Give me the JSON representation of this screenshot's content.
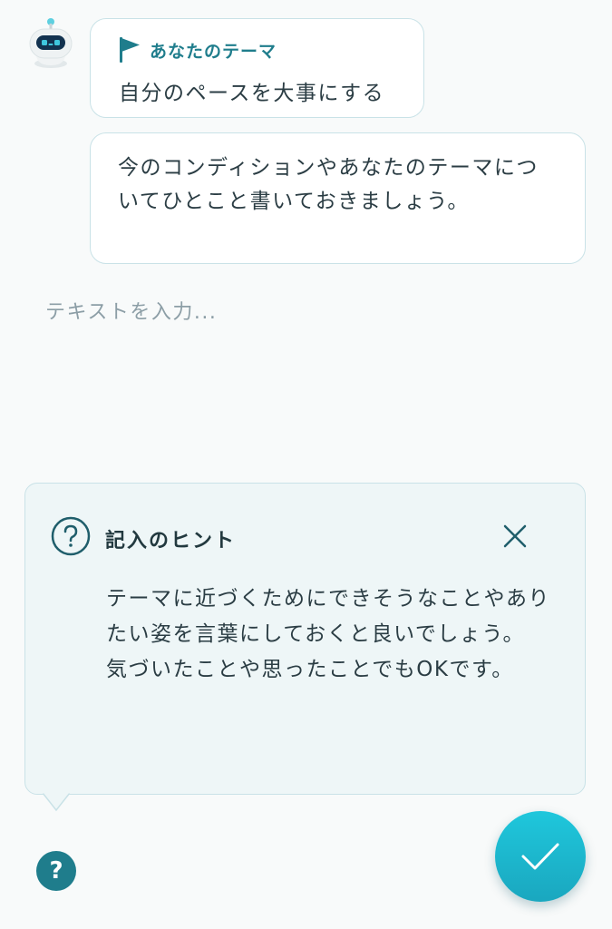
{
  "theme_card": {
    "label": "あなたのテーマ",
    "icon": "flag-icon",
    "text": "自分のペースを大事にする"
  },
  "prompt_message": {
    "text": "今のコンディションやあなたのテーマについてひとこと書いておきましょう。"
  },
  "input": {
    "placeholder": "テキストを入力...",
    "value": ""
  },
  "hint": {
    "title": "記入のヒント",
    "icon": "question-circle-icon",
    "close_icon": "close-icon",
    "body_line1": "テーマに近づくためにできそうなことやありたい姿を言葉にしておくと良いでしょう。",
    "body_line2": "気づいたことや思ったことでもOKです。"
  },
  "help_button": {
    "label": "?",
    "icon": "help-icon"
  },
  "confirm_button": {
    "icon": "check-icon"
  },
  "colors": {
    "accent": "#1f7d8c",
    "fab": "#1bb8cf",
    "background": "#f8fafa",
    "hint_background": "#eef6f7",
    "border": "#c9e2e7"
  }
}
